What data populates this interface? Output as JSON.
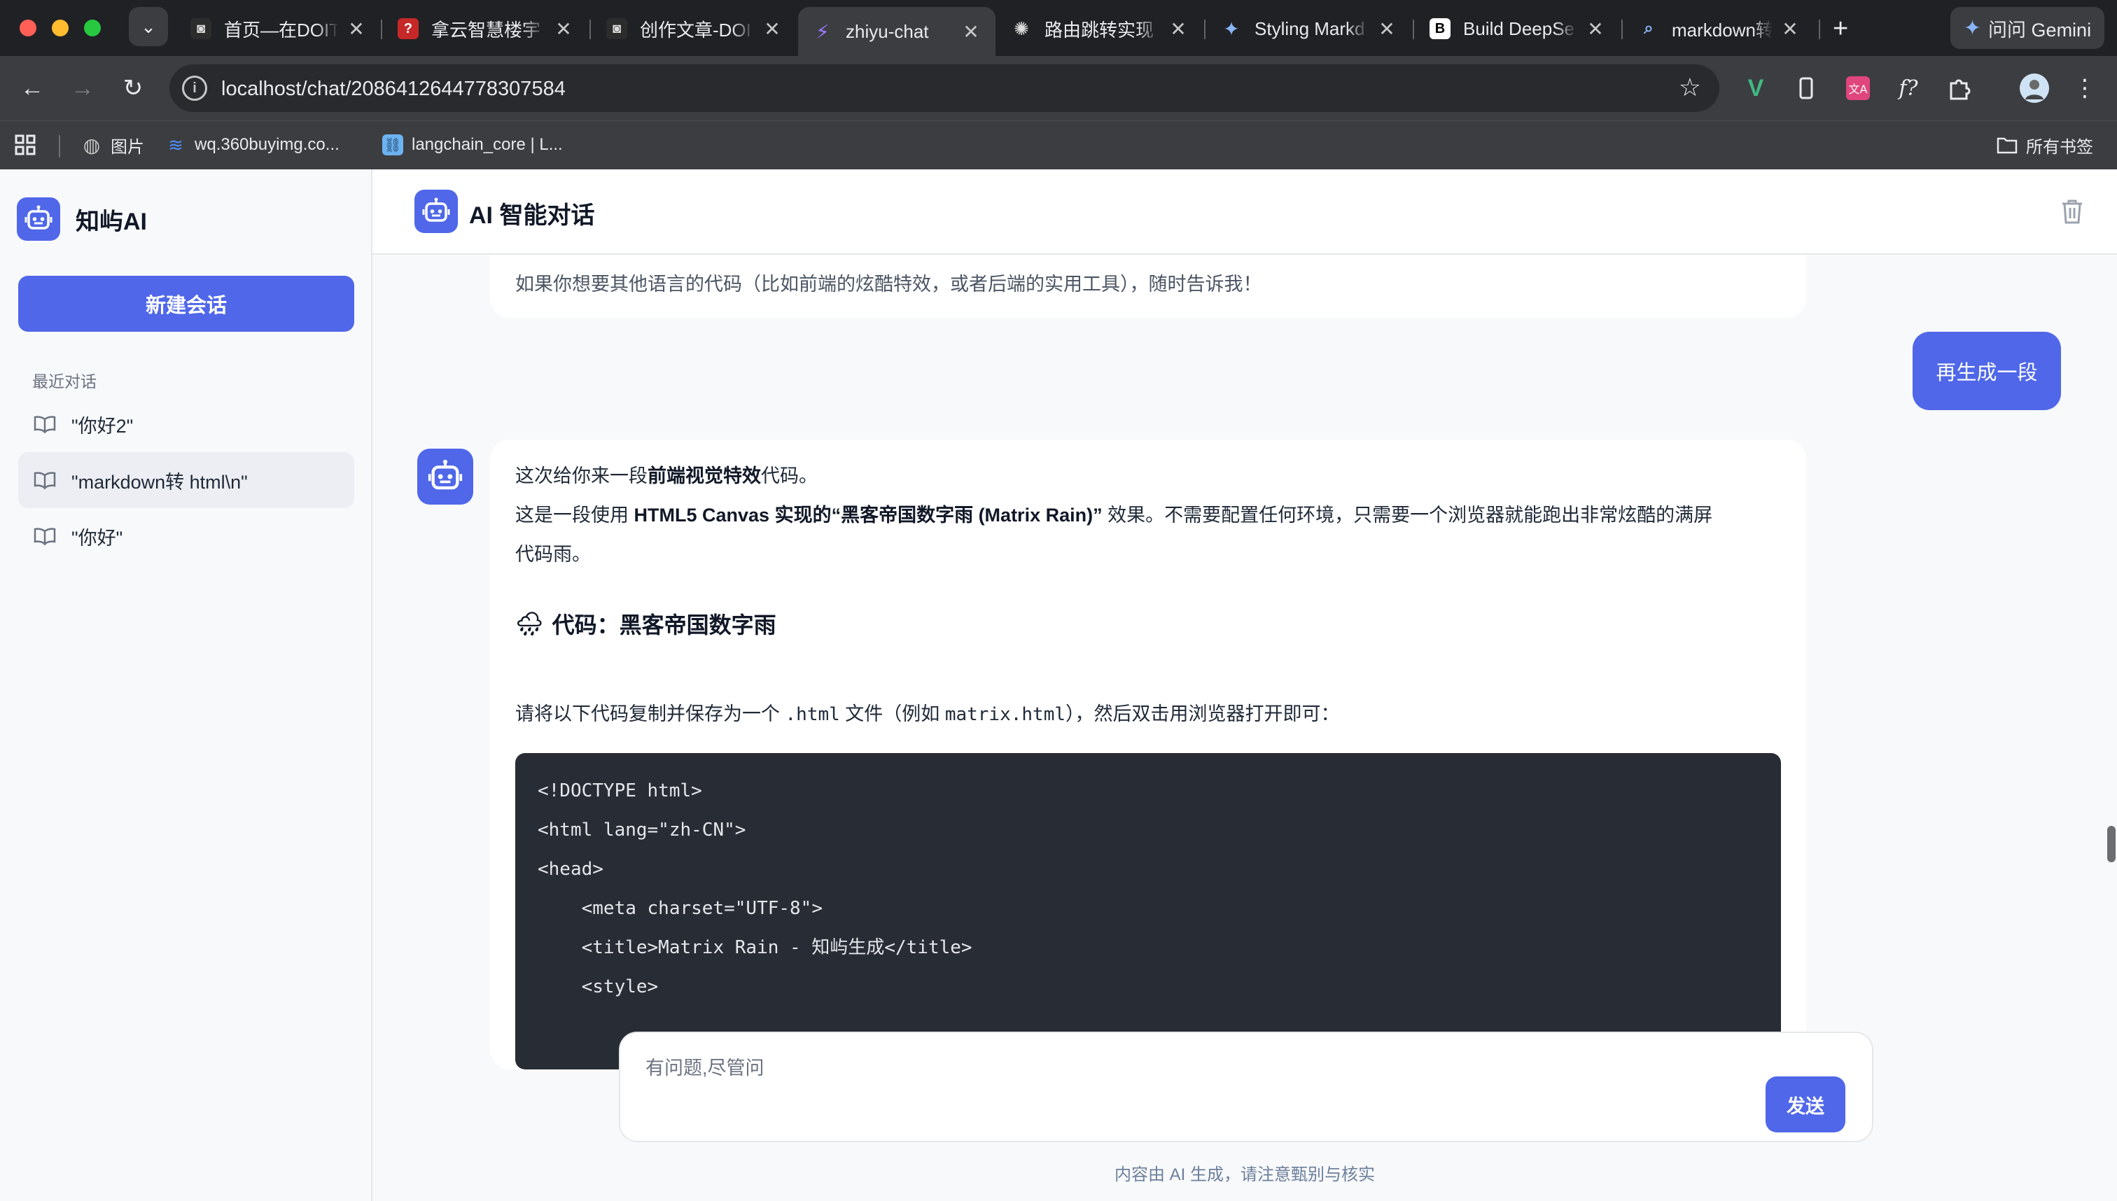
{
  "browser": {
    "tabs": [
      {
        "title": "首页—在DOIT",
        "active": false
      },
      {
        "title": "拿云智慧楼宇",
        "active": false
      },
      {
        "title": "创作文章-DOI",
        "active": false
      },
      {
        "title": "zhiyu-chat",
        "active": true
      },
      {
        "title": "路由跳转实现",
        "active": false
      },
      {
        "title": "Styling Markd",
        "active": false
      },
      {
        "title": "Build DeepSe",
        "active": false
      },
      {
        "title": "markdown转h",
        "active": false
      }
    ],
    "new_tab_glyph": "+",
    "gemini_label": "问问 Gemini",
    "url": "localhost/chat/2086412644778307584",
    "bookmarks": [
      "图片",
      "wq.360buyimg.co...",
      "langchain_core | L..."
    ],
    "all_bookmarks_label": "所有书签"
  },
  "sidebar": {
    "brand_name": "知屿AI",
    "new_chat_label": "新建会话",
    "recent_label": "最近对话",
    "conversations": [
      {
        "title": "\"你好2\"",
        "selected": false
      },
      {
        "title": "\"markdown转 html\\n\"",
        "selected": true
      },
      {
        "title": "\"你好\"",
        "selected": false
      }
    ]
  },
  "header": {
    "title": "AI 智能对话"
  },
  "chat": {
    "previous_partial_text": "如果你想要其他语言的代码（比如前端的炫酷特效，或者后端的实用工具），随时告诉我！",
    "user_message": "再生成一段",
    "ai_message": {
      "line1_pre": "这次给你来一段",
      "line1_bold": "前端视觉特效",
      "line1_post": "代码。",
      "line2_pre": "这是一段使用 ",
      "line2_bold": "HTML5 Canvas 实现的“黑客帝国数字雨 (Matrix Rain)”",
      "line2_post": " 效果。不需要配置任何环境，只需要一个浏览器就能跑出非常炫酷的满屏",
      "line3": "代码雨。",
      "heading_emoji": "🌧",
      "heading": "代码：黑客帝国数字雨",
      "instr_pre": "请将以下代码复制并保存为一个 ",
      "instr_code1": ".html",
      "instr_mid": " 文件（例如 ",
      "instr_code2": "matrix.html",
      "instr_post": "），然后双击用浏览器打开即可：",
      "code_lines": [
        "<!DOCTYPE html>",
        "<html lang=\"zh-CN\">",
        "<head>",
        "    <meta charset=\"UTF-8\">",
        "    <title>Matrix Rain - 知屿生成</title>",
        "    <style>"
      ]
    }
  },
  "composer": {
    "placeholder": "有问题,尽管问",
    "send_label": "发送"
  },
  "footer": {
    "disclaimer": "内容由 AI 生成，请注意甄别与核实"
  },
  "colors": {
    "accent": "#4f67e8",
    "code_bg": "#282c34",
    "browser_chrome": "#202124"
  }
}
